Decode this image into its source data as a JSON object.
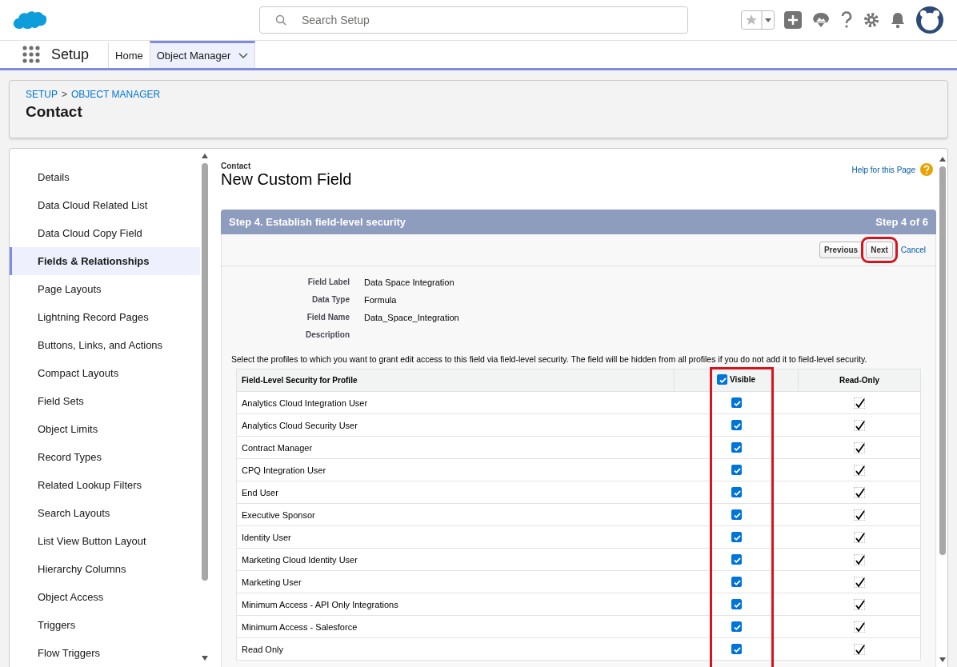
{
  "header": {
    "search": {
      "placeholder": "Search Setup"
    }
  },
  "nav": {
    "app_name": "Setup",
    "tabs": [
      {
        "label": "Home",
        "selected": false
      },
      {
        "label": "Object Manager",
        "selected": true
      }
    ]
  },
  "page_header": {
    "breadcrumbs": [
      "SETUP",
      "OBJECT MANAGER"
    ],
    "separator": ">",
    "title": "Contact"
  },
  "sidebar": {
    "items": [
      {
        "label": "Details",
        "selected": false
      },
      {
        "label": "Data Cloud Related List",
        "selected": false
      },
      {
        "label": "Data Cloud Copy Field",
        "selected": false
      },
      {
        "label": "Fields & Relationships",
        "selected": true
      },
      {
        "label": "Page Layouts",
        "selected": false
      },
      {
        "label": "Lightning Record Pages",
        "selected": false
      },
      {
        "label": "Buttons, Links, and Actions",
        "selected": false
      },
      {
        "label": "Compact Layouts",
        "selected": false
      },
      {
        "label": "Field Sets",
        "selected": false
      },
      {
        "label": "Object Limits",
        "selected": false
      },
      {
        "label": "Record Types",
        "selected": false
      },
      {
        "label": "Related Lookup Filters",
        "selected": false
      },
      {
        "label": "Search Layouts",
        "selected": false
      },
      {
        "label": "List View Button Layout",
        "selected": false
      },
      {
        "label": "Hierarchy Columns",
        "selected": false
      },
      {
        "label": "Object Access",
        "selected": false
      },
      {
        "label": "Triggers",
        "selected": false
      },
      {
        "label": "Flow Triggers",
        "selected": false
      }
    ]
  },
  "content": {
    "object": "Contact",
    "title": "New Custom Field",
    "help_link": "Help for this Page",
    "step": {
      "title": "Step 4. Establish field-level security",
      "counter": "Step 4 of 6"
    },
    "buttons": [
      {
        "label": "Previous",
        "highlighted": false
      },
      {
        "label": "Next",
        "highlighted": true
      }
    ],
    "cancel": "Cancel",
    "fields": [
      {
        "label": "Field Label",
        "value": "Data Space Integration"
      },
      {
        "label": "Data Type",
        "value": "Formula"
      },
      {
        "label": "Field Name",
        "value": "Data_Space_Integration"
      },
      {
        "label": "Description"
      }
    ],
    "instructions": "Select the profiles to which you want to grant edit access to this field via field-level security. The field will be hidden from all profiles if you do not add it to field-level security.",
    "table": {
      "columns": [
        "Field-Level Security for Profile",
        "Visible",
        "Read-Only"
      ],
      "visible_all_checked": true,
      "visible_highlighted": true,
      "rows": [
        {
          "profile": "Analytics Cloud Integration User",
          "visible": true,
          "read_only": true
        },
        {
          "profile": "Analytics Cloud Security User",
          "visible": true,
          "read_only": true
        },
        {
          "profile": "Contract Manager",
          "visible": true,
          "read_only": true
        },
        {
          "profile": "CPQ Integration User",
          "visible": true,
          "read_only": true
        },
        {
          "profile": "End User",
          "visible": true,
          "read_only": true
        },
        {
          "profile": "Executive Sponsor",
          "visible": true,
          "read_only": true
        },
        {
          "profile": "Identity User",
          "visible": true,
          "read_only": true
        },
        {
          "profile": "Marketing Cloud Identity User",
          "visible": true,
          "read_only": true
        },
        {
          "profile": "Marketing User",
          "visible": true,
          "read_only": true
        },
        {
          "profile": "Minimum Access - API Only Integrations",
          "visible": true,
          "read_only": true
        },
        {
          "profile": "Minimum Access - Salesforce",
          "visible": true,
          "read_only": true
        },
        {
          "profile": "Read Only",
          "visible": true,
          "read_only": true
        }
      ]
    }
  }
}
